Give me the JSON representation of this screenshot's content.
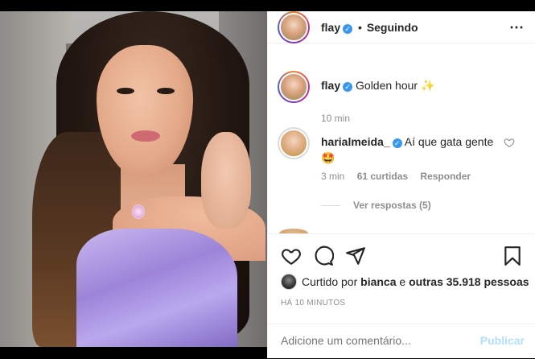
{
  "post": {
    "author": "flay",
    "follow_status": "Seguindo",
    "separator": "•",
    "more_icon": "⋯"
  },
  "caption": {
    "username": "flay",
    "text": "Golden hour",
    "emoji": "✨",
    "time": "10 min"
  },
  "comment1": {
    "username": "harialmeida_",
    "text": "Aí que gata gente",
    "emoji": "🤩",
    "time": "3 min",
    "likes": "61 curtidas",
    "reply": "Responder",
    "view_replies": "Ver respostas (5)"
  },
  "likes": {
    "prefix": "Curtido por",
    "user": "bianca",
    "middle": "e",
    "others": "outras 35.918 pessoas"
  },
  "timestamp": "HÁ 10 MINUTOS",
  "add_comment": {
    "placeholder": "Adicione um comentário...",
    "post": "Publicar"
  },
  "colors": {
    "verified": "#3897f0",
    "publish_disabled": "#b2dffc",
    "muted": "#8e8e8e",
    "text": "#262626"
  },
  "icons": {
    "like": "heart-icon",
    "comment": "comment-icon",
    "share": "share-icon",
    "save": "bookmark-icon",
    "verified": "verified-badge-icon"
  }
}
